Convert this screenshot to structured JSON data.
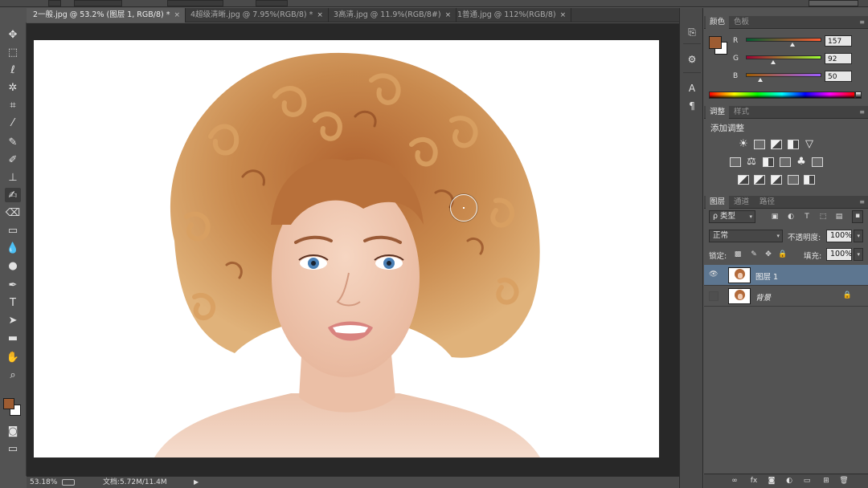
{
  "tabs": [
    {
      "label": "2一般.jpg @ 53.2% (图层 1, RGB/8) *",
      "active": true
    },
    {
      "label": "4超级清晰.jpg @ 7.95%(RGB/8) *",
      "active": false
    },
    {
      "label": "3高清.jpg @ 11.9%(RGB/8#)",
      "active": false
    },
    {
      "label": "1普通.jpg @ 112%(RGB/8)",
      "active": false
    }
  ],
  "tab_close_glyph": "×",
  "tools": [
    {
      "name": "move-tool",
      "glyph": "✥"
    },
    {
      "name": "marquee-tool",
      "glyph": "⬚"
    },
    {
      "name": "lasso-tool",
      "glyph": "ℓ"
    },
    {
      "name": "magic-wand-tool",
      "glyph": "✲"
    },
    {
      "name": "crop-tool",
      "glyph": "⌗"
    },
    {
      "name": "eyedropper-tool",
      "glyph": "⁄"
    },
    {
      "name": "healing-brush-tool",
      "glyph": "✎"
    },
    {
      "name": "brush-tool",
      "glyph": "✐"
    },
    {
      "name": "clone-stamp-tool",
      "glyph": "⊥"
    },
    {
      "name": "history-brush-tool",
      "glyph": "✍"
    },
    {
      "name": "eraser-tool",
      "glyph": "⌫"
    },
    {
      "name": "gradient-tool",
      "glyph": "▭"
    },
    {
      "name": "blur-tool",
      "glyph": "💧"
    },
    {
      "name": "dodge-tool",
      "glyph": "●"
    },
    {
      "name": "pen-tool",
      "glyph": "✒"
    },
    {
      "name": "type-tool",
      "glyph": "T"
    },
    {
      "name": "path-selection-tool",
      "glyph": "➤"
    },
    {
      "name": "shape-tool",
      "glyph": "▬"
    },
    {
      "name": "hand-tool",
      "glyph": "✋"
    },
    {
      "name": "zoom-tool",
      "glyph": "⌕"
    }
  ],
  "status": {
    "zoom": "53.18%",
    "doc": "文档:5.72M/11.4M",
    "arrow": "▶"
  },
  "color_panel": {
    "tabs": [
      "颜色",
      "色板"
    ],
    "fg_color": "#9d5c32",
    "channels": [
      {
        "label": "R",
        "value": "157",
        "level": 0.616,
        "grad": "linear-gradient(to right,#005c32,#ff5c32)"
      },
      {
        "label": "G",
        "value": "92",
        "level": 0.361,
        "grad": "linear-gradient(to right,#9d0032,#9dff32)"
      },
      {
        "label": "B",
        "value": "50",
        "level": 0.196,
        "grad": "linear-gradient(to right,#9d5c00,#9d5cff)"
      }
    ]
  },
  "adjust_panel": {
    "tabs": [
      "调整",
      "样式"
    ],
    "title": "添加调整"
  },
  "layers_panel": {
    "tabs": [
      "图层",
      "通道",
      "路径"
    ],
    "filter": "ρ 类型",
    "blend_mode": "正常",
    "opacity_label": "不透明度:",
    "opacity": "100%",
    "lock_label": "锁定:",
    "fill_label": "填充:",
    "fill": "100%",
    "layers": [
      {
        "name": "图层 1",
        "visible": true,
        "selected": true,
        "locked": false
      },
      {
        "name": "背景",
        "visible": false,
        "selected": false,
        "locked": true
      }
    ]
  },
  "glyphs": {
    "panel_menu": "≡",
    "dropdown": "▾",
    "eye": "👁",
    "lock": "🔒"
  }
}
